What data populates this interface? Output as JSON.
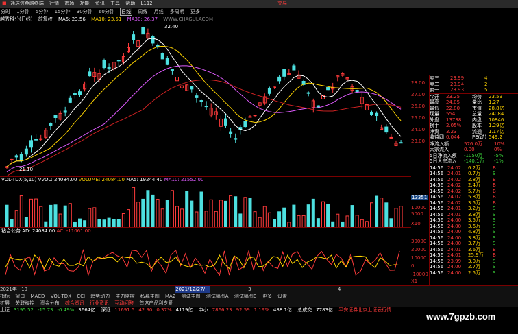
{
  "topbar": {
    "title": "通达信金融终端",
    "menus": [
      "行情",
      "市场",
      "功能",
      "资讯",
      "工具",
      "帮助",
      "L112"
    ],
    "right": "交易"
  },
  "menubar": {
    "items": [
      "分时",
      "1分钟",
      "5分钟",
      "15分钟",
      "30分钟",
      "60分钟",
      "日线",
      "周线",
      "月线",
      "多周期",
      "更多"
    ],
    "active": "日线"
  },
  "infobar": {
    "stock": "越秀科分(日线)",
    "mode": "前复权",
    "ma5": "MA5: 23.56",
    "ma10": "MA10: 23.51",
    "ma30": "MA30: 26.37",
    "site": "WWW.CHAGULACOM"
  },
  "main": {
    "high_label": "32.40",
    "low_label": "21.10",
    "axis": [
      "28.00",
      "27.00",
      "26.00",
      "25.00",
      "24.00",
      "23.00"
    ]
  },
  "vol": {
    "header": "VOL-TDX(5,10) VVOL: 24084.00",
    "vol_label": "VOLUME: 24084.00",
    "ma5": "MA5: 19244.40",
    "ma10": "MA10: 21552.00",
    "axis": [
      "13351",
      "10000",
      "5000",
      "X10"
    ],
    "marker": "13351"
  },
  "ind": {
    "header": "粘合公务 AD: 24084.00",
    "ac": "AC: -11061.00",
    "axis": [
      "30000",
      "20000",
      "10000",
      "0",
      "-10000",
      "X1"
    ]
  },
  "quote": {
    "asks": [
      {
        "l": "卖三",
        "p": "23.99",
        "v": "4"
      },
      {
        "l": "卖二",
        "p": "23.94",
        "v": "2"
      },
      {
        "l": "卖一",
        "p": "23.93",
        "v": "5"
      }
    ],
    "stats": [
      [
        "今开",
        "23.25",
        "均价",
        "23.59"
      ],
      [
        "最高",
        "24.05",
        "量比",
        "1.27"
      ],
      [
        "最低",
        "22.80",
        "市值",
        "28.8亿"
      ],
      [
        "现量",
        "554",
        "总量",
        "24084"
      ],
      [
        "外盘",
        "13738",
        "内盘",
        "10846"
      ],
      [
        "换手",
        "2.05%",
        "股本",
        "1.29亿"
      ],
      [
        "净资",
        "3.23",
        "流通",
        "1.17亿"
      ],
      [
        "收益四",
        "0.044",
        "PE(动)",
        "549.2"
      ]
    ],
    "flows": [
      [
        "净流入额",
        "576.0万",
        "10%"
      ],
      [
        "大宗流入",
        "0.00",
        "0%"
      ],
      [
        "5日净流入额",
        "-1050万",
        "-5%"
      ],
      [
        "5日大宗流入",
        "-140.1万",
        "-1%"
      ]
    ],
    "ticks": [
      [
        "14:56",
        "24.02",
        "6.2万",
        "B"
      ],
      [
        "14:56",
        "24.01",
        "0.7万",
        "S"
      ],
      [
        "14:56",
        "24.02",
        "2.8万",
        "B"
      ],
      [
        "14:56",
        "24.02",
        "2.4万",
        "B"
      ],
      [
        "14:56",
        "24.02",
        "5.7万",
        "B"
      ],
      [
        "14:56",
        "24.02",
        "5.8万",
        "B"
      ],
      [
        "14:56",
        "24.02",
        "3.5万",
        "B"
      ],
      [
        "14:56",
        "24.01",
        "3.2万",
        "S"
      ],
      [
        "14:56",
        "24.01",
        "3.8万",
        "S"
      ],
      [
        "14:56",
        "24.00",
        "3.5万",
        "S"
      ],
      [
        "14:56",
        "24.00",
        "3.6万",
        "S"
      ],
      [
        "14:56",
        "24.00",
        "4.8万",
        "S"
      ],
      [
        "14:56",
        "24.00",
        "3.8万",
        "S"
      ],
      [
        "14:56",
        "24.00",
        "3.7万",
        "S"
      ],
      [
        "14:56",
        "24.01",
        "3.6万",
        "B"
      ],
      [
        "14:56",
        "24.01",
        "25.9万",
        "B"
      ],
      [
        "14:56",
        "23.99",
        "3.0万",
        "S"
      ],
      [
        "14:56",
        "24.00",
        "2.7万",
        "S"
      ],
      [
        "14:56",
        "24.00",
        "2.5万",
        "S"
      ]
    ]
  },
  "dates": [
    "2021年",
    "10",
    "2021/12/27/一",
    "3",
    "4"
  ],
  "bottomtabs": [
    "指标",
    "窗口",
    "MACD",
    "VOL-TDX",
    "CCI",
    "趋势动力",
    "主力监控",
    "私募主图",
    "MA2",
    "测试主图",
    "测试幅图A",
    "测试幅图B",
    "更多",
    "设置"
  ],
  "funcbar": [
    "扩展",
    "关联权控",
    "资金分布",
    "综合资讯",
    "行业资讯",
    "互动问答",
    "首席产品利专爱"
  ],
  "statusbar": {
    "items": [
      {
        "n": "上证",
        "v": "3195.52",
        "c": "-15.73",
        "p": "-0.49%",
        "a": "3664亿"
      },
      {
        "n": "深证",
        "v": "11691.5",
        "c": "42.90",
        "p": "0.37%",
        "a": "4119亿"
      },
      {
        "n": "中小",
        "v": "7866.23",
        "c": "92.59",
        "p": "1.19%",
        "a": "488.1亿"
      },
      {
        "n": "总成交",
        "v": "7783亿",
        "c": "",
        "p": "",
        "a": ""
      }
    ],
    "right": "平安证券北京上证云行情"
  },
  "watermark": "www.7gpzb.com",
  "colors": {
    "up": "#ff3b3b",
    "down": "#4de0e0",
    "ma5": "#ffffff",
    "ma10": "#ffd400",
    "ma30": "#e05cff"
  }
}
